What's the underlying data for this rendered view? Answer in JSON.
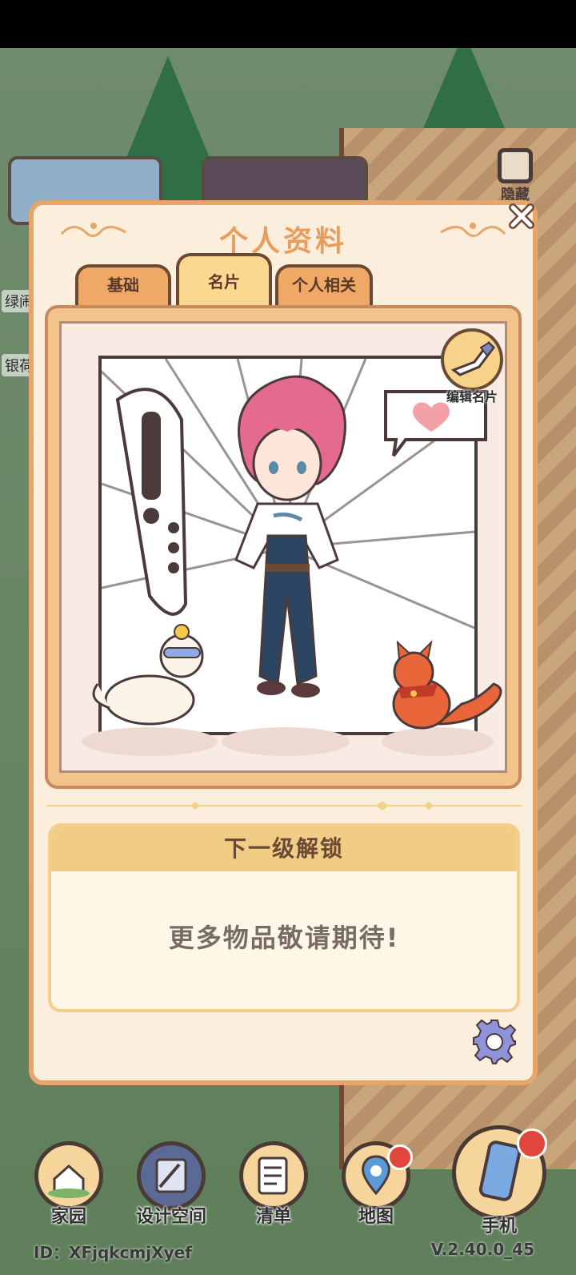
{
  "panel": {
    "title": "个人资料",
    "close_icon": "close-icon"
  },
  "hide_button": {
    "label": "隐藏",
    "icon": "fullscreen-frame-icon"
  },
  "left_labels": [
    "绿闹",
    "银荷"
  ],
  "tabs": [
    {
      "label": "基础",
      "active": false
    },
    {
      "label": "名片",
      "active": true
    },
    {
      "label": "个人相关",
      "active": false
    }
  ],
  "card": {
    "edit_label": "编辑名片",
    "edit_icon": "pencil-icon"
  },
  "unlock": {
    "header": "下一级解锁",
    "message": "更多物品敬请期待!"
  },
  "settings_icon": "gear-icon",
  "nav": [
    {
      "label": "家园",
      "icon": "home-icon",
      "badge": false
    },
    {
      "label": "设计空间",
      "icon": "design-icon",
      "badge": false
    },
    {
      "label": "清单",
      "icon": "list-icon",
      "badge": false
    },
    {
      "label": "地图",
      "icon": "map-pin-icon",
      "badge": true
    },
    {
      "label": "手机",
      "icon": "phone-icon",
      "badge": true
    }
  ],
  "footer": {
    "id_text": "ID：XFjqkcmjXyef",
    "version": "V.2.40.0_45"
  },
  "colors": {
    "accent": "#e8a56a",
    "title": "#e79d5c",
    "badge": "#e0463c"
  }
}
